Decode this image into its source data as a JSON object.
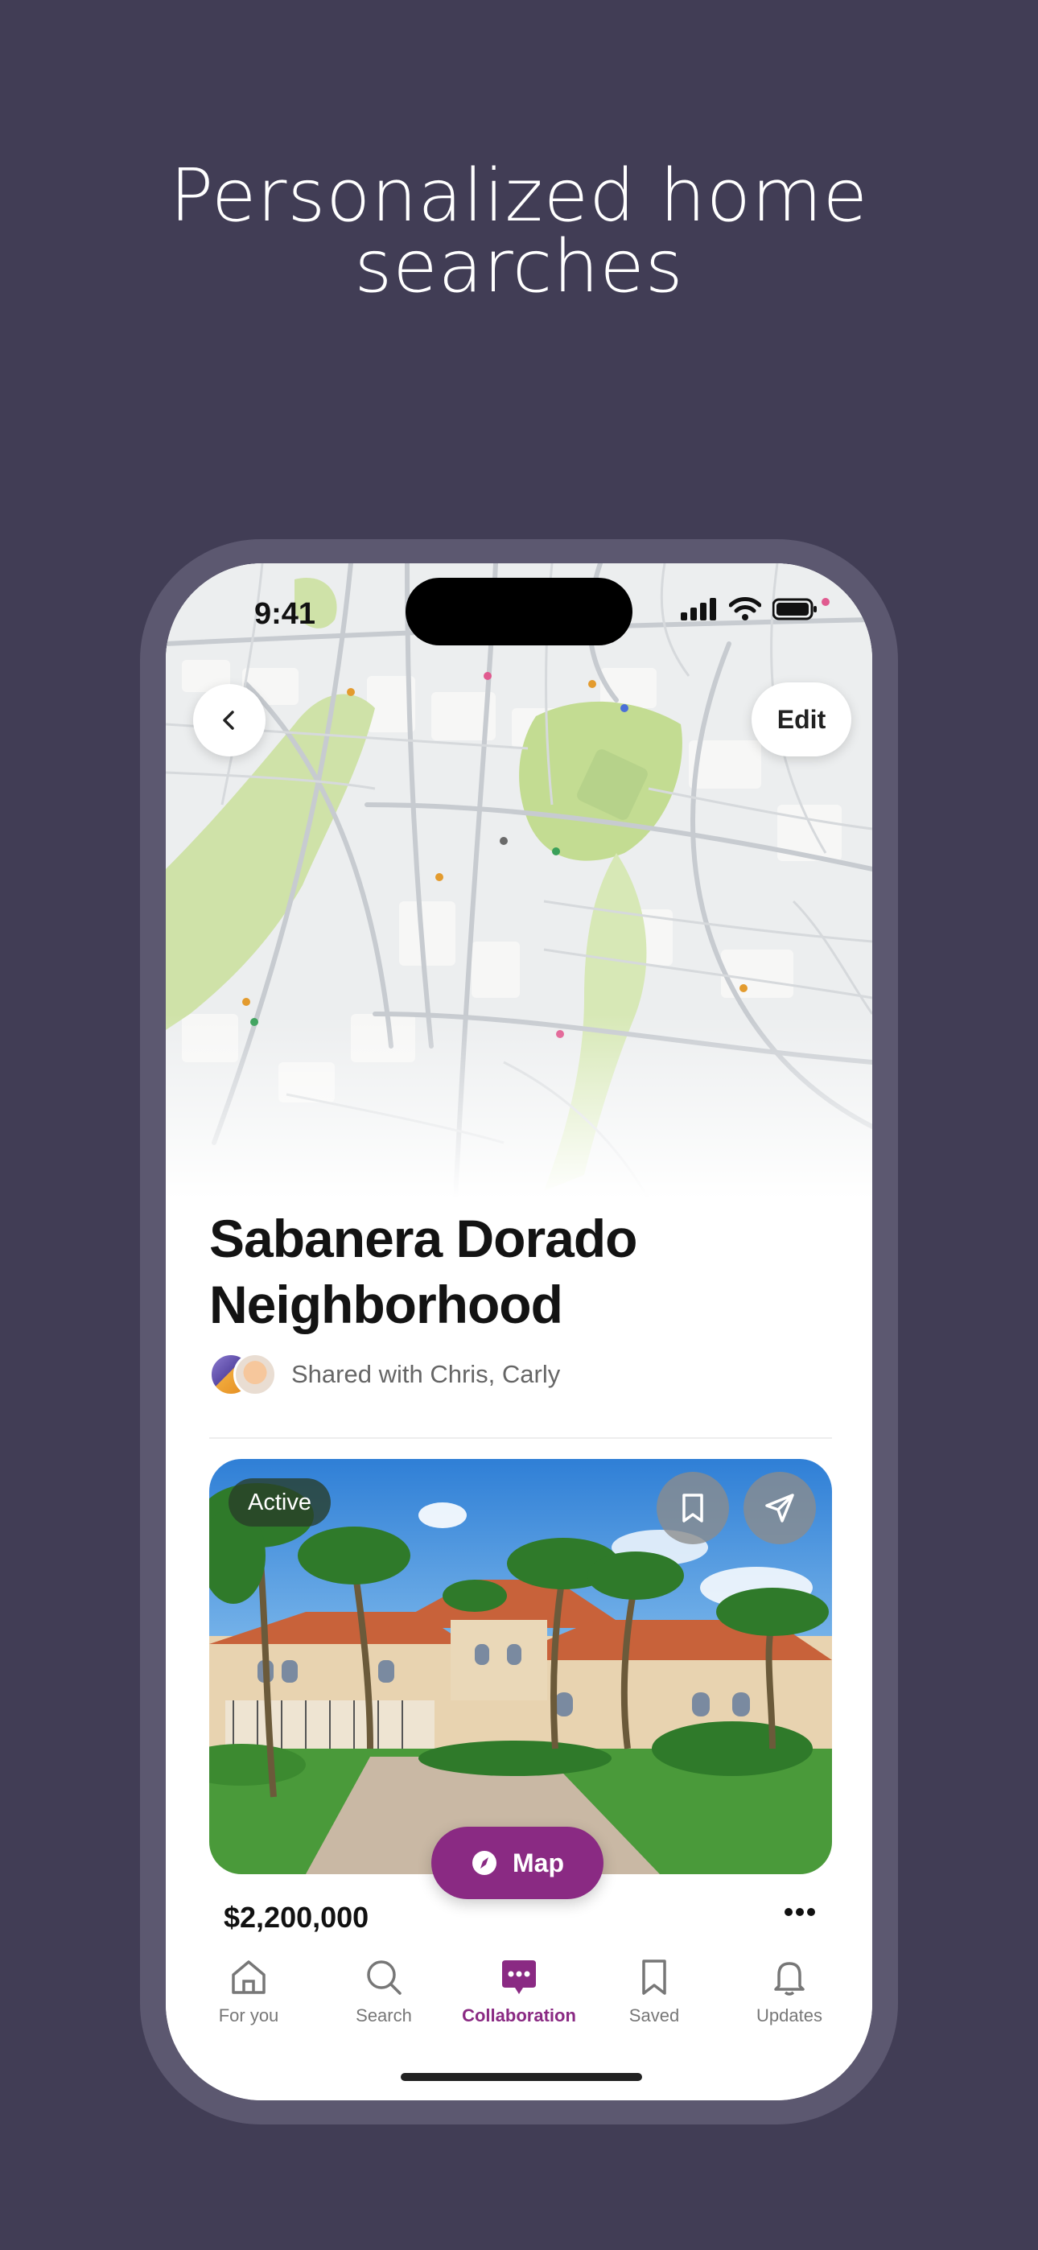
{
  "headline": {
    "line1": "Personalized home",
    "line2": "searches"
  },
  "status_bar": {
    "time": "9:41"
  },
  "nav": {
    "back_icon": "chevron-left-icon",
    "edit_label": "Edit"
  },
  "search": {
    "title_line1": "Sabanera Dorado",
    "title_line2": "Neighborhood",
    "shared_text": "Shared with Chris, Carly"
  },
  "listing": {
    "status_badge": "Active",
    "price": "$2,200,000",
    "save_icon": "bookmark-icon",
    "share_icon": "send-icon"
  },
  "map_button": {
    "label": "Map",
    "icon": "compass-icon"
  },
  "tabs": [
    {
      "label": "For you",
      "icon": "home-icon",
      "active": false
    },
    {
      "label": "Search",
      "icon": "search-icon",
      "active": false
    },
    {
      "label": "Collaboration",
      "icon": "chat-icon",
      "active": true
    },
    {
      "label": "Saved",
      "icon": "bookmark-icon",
      "active": false
    },
    {
      "label": "Updates",
      "icon": "bell-icon",
      "active": false
    }
  ],
  "colors": {
    "background": "#413d55",
    "accent": "#8a2a83",
    "park_green": "#c9df9f"
  }
}
